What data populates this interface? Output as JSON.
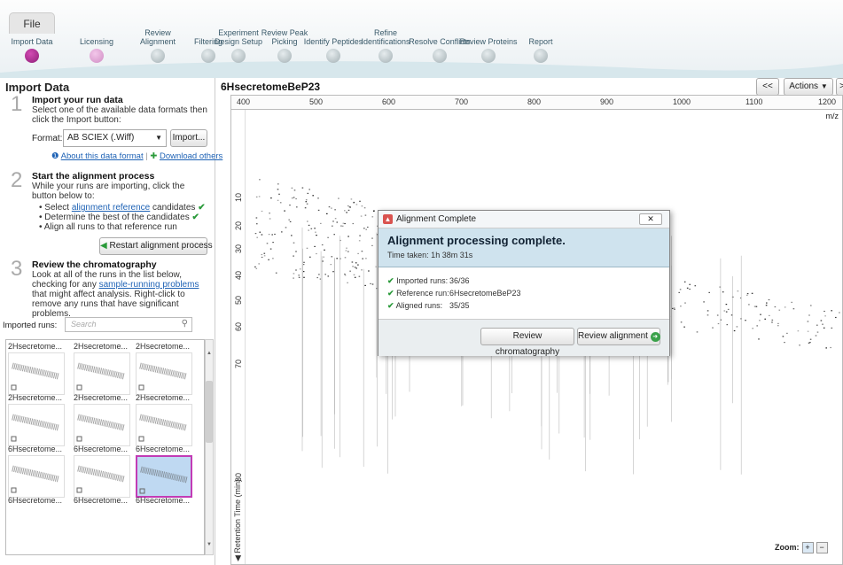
{
  "menu": {
    "file": "File"
  },
  "steps": [
    {
      "label": "Import Data",
      "state": "done"
    },
    {
      "label": "Licensing",
      "state": "current"
    },
    {
      "label": "Review Alignment",
      "state": "todo"
    },
    {
      "label": "Filtering",
      "state": "todo"
    },
    {
      "label": "Experiment Design Setup",
      "state": "todo"
    },
    {
      "label": "Review Peak Picking",
      "state": "todo"
    },
    {
      "label": "Identify Peptides",
      "state": "todo"
    },
    {
      "label": "Refine Identifications",
      "state": "todo"
    },
    {
      "label": "Resolve Conflicts",
      "state": "todo"
    },
    {
      "label": "Review Proteins",
      "state": "todo"
    },
    {
      "label": "Report",
      "state": "todo"
    }
  ],
  "left": {
    "title": "Import Data",
    "s1": {
      "num": "1",
      "title": "Import your run data",
      "text": "Select one of the available data formats then click the Import button:",
      "format_label": "Format:",
      "format_value": "AB SCIEX (.Wiff)",
      "import_button": "Import...",
      "about_link": "About this data format",
      "download_link": "Download others"
    },
    "s2": {
      "num": "2",
      "title": "Start the alignment process",
      "text": "While your runs are importing, click the button below to:",
      "b1_pre": "Select ",
      "b1_link": "alignment reference",
      "b1_post": " candidates",
      "b2": "Determine the best of the candidates",
      "b3": "Align all runs to that reference run",
      "restart_button": "Restart alignment process"
    },
    "s3": {
      "num": "3",
      "title": "Review the chromatography",
      "text_pre": "Look at all of the runs in the list below, checking for any ",
      "text_link": "sample-running problems",
      "text_post": " that might affect analysis. Right-click to remove any runs that have significant problems."
    },
    "imported_label": "Imported runs:",
    "search_placeholder": "Search",
    "thumbs": [
      [
        "2Hsecretome...",
        "2Hsecretome...",
        "2Hsecretome..."
      ],
      [
        "2Hsecretome...",
        "2Hsecretome...",
        "2Hsecretome..."
      ],
      [
        "6Hsecretome...",
        "6Hsecretome...",
        "6Hsecretome..."
      ],
      [
        "6Hsecretome...",
        "6Hsecretome...",
        "6Hsecretome..."
      ]
    ]
  },
  "main": {
    "title": "6HsecretomeBeP23",
    "nav_prev": "<<",
    "actions": "Actions",
    "nav_next": ">",
    "x_ticks": [
      "400",
      "500",
      "600",
      "700",
      "800",
      "900",
      "1000",
      "1100",
      "1200"
    ],
    "x_unit": "m/z",
    "y_ticks": [
      "10",
      "20",
      "30",
      "40",
      "50",
      "60",
      "70",
      "80"
    ],
    "y_label": "Retention Time (min)",
    "zoom_label": "Zoom:"
  },
  "dialog": {
    "title": "Alignment Complete",
    "heading": "Alignment processing complete.",
    "time": "Time taken: 1h 38m 31s",
    "rows": [
      {
        "label": "Imported runs:",
        "value": "36/36"
      },
      {
        "label": "Reference run:",
        "value": "6HsecretomeBeP23"
      },
      {
        "label": "Aligned runs:",
        "value": "35/35"
      }
    ],
    "btn_chrom": "Review chromatography",
    "btn_align": "Review alignment"
  }
}
